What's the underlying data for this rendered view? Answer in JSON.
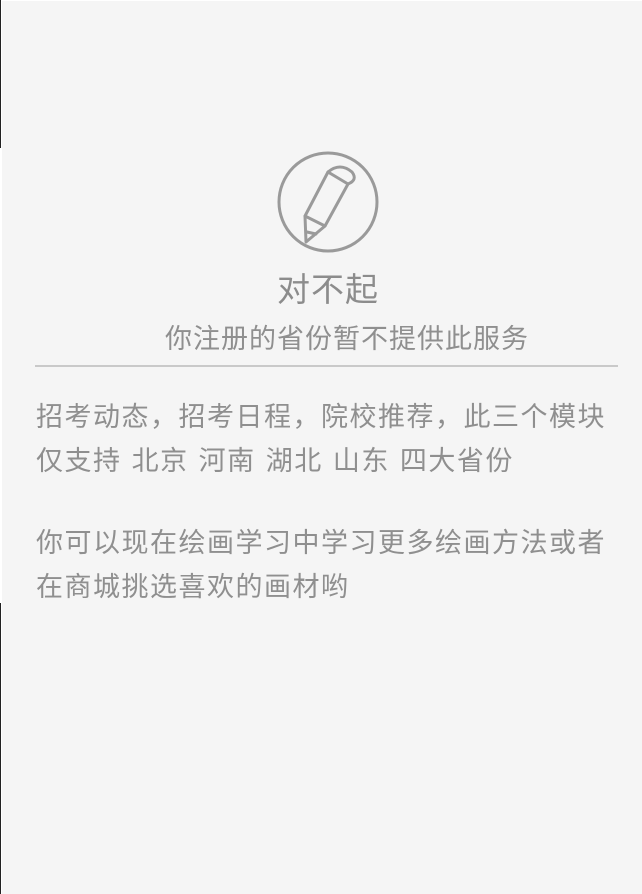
{
  "notice": {
    "icon": "pencil-circle-icon",
    "title": "对不起",
    "subtitle": "你注册的省份暂不提供此服务"
  },
  "message": {
    "paragraph1": "招考动态，招考日程，院校推荐，此三个模块仅支持 北京 河南 湖北 山东 四大省份",
    "paragraph2": "你可以现在绘画学习中学习更多绘画方法或者在商城挑选喜欢的画材哟"
  },
  "colors": {
    "background": "#f5f5f5",
    "text": "#8f8f8f",
    "divider": "#c9c9c9",
    "icon_stroke": "#9a9a9a"
  }
}
